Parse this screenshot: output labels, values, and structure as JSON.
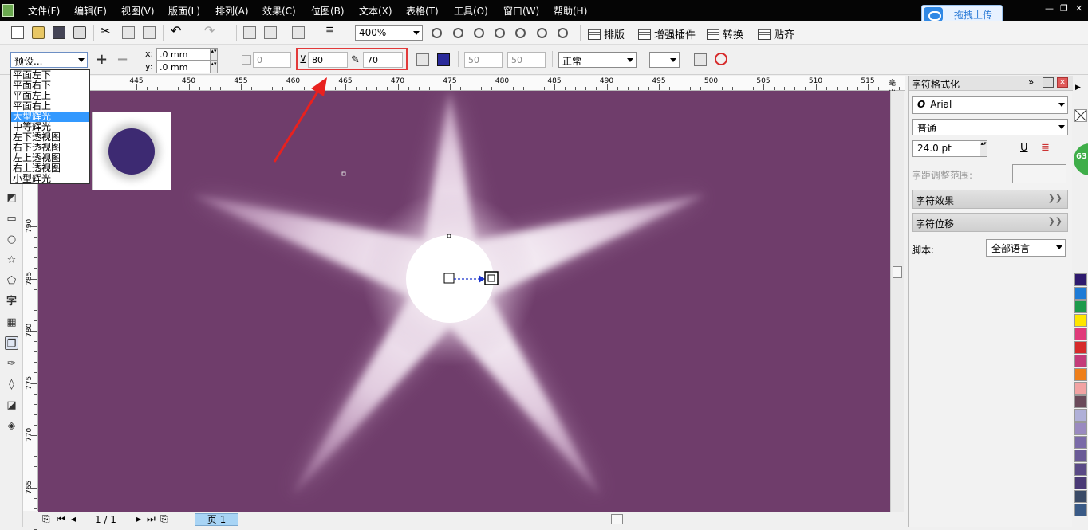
{
  "menu": [
    "文件(F)",
    "编辑(E)",
    "视图(V)",
    "版面(L)",
    "排列(A)",
    "效果(C)",
    "位图(B)",
    "文本(X)",
    "表格(T)",
    "工具(O)",
    "窗口(W)",
    "帮助(H)"
  ],
  "upload_button": "拖拽上传",
  "window_controls": {
    "minimize": "—",
    "restore": "❐",
    "close": "✕"
  },
  "toolbar1": {
    "zoom_level": "400%",
    "buttons": [
      "排版",
      "增强插件",
      "转换",
      "贴齐"
    ]
  },
  "toolbar2": {
    "preset": "预设...",
    "x_label": "x:",
    "y_label": "y:",
    "x_value": ".0 mm",
    "y_value": ".0 mm",
    "offset_value": "0",
    "opacity": "80",
    "feather": "70",
    "field_a": "50",
    "field_b": "50",
    "merge_mode": "正常"
  },
  "preset_options": [
    "平面左下",
    "平面右下",
    "平面左上",
    "平面右上",
    "大型辉光",
    "中等辉光",
    "左下透视图",
    "右下透视图",
    "左上透视图",
    "右上透视图",
    "小型辉光"
  ],
  "preset_selected_index": 4,
  "ruler_h": [
    "445",
    "450",
    "455",
    "460",
    "465",
    "470",
    "475",
    "480",
    "485",
    "490",
    "495",
    "500",
    "505",
    "510",
    "515",
    "毫米"
  ],
  "ruler_v": [
    "790",
    "785",
    "780",
    "775",
    "770",
    "765"
  ],
  "page_nav": {
    "counter": "1 / 1",
    "tab": "页 1"
  },
  "docker": {
    "title": "字符格式化",
    "font": "Arial",
    "style": "普通",
    "size": "24.0 pt",
    "spacing_label": "字距调整范围:",
    "section1": "字符效果",
    "section2": "字符位移",
    "script_label": "脚本:",
    "script_value": "全部语言"
  },
  "palette_badge": "63",
  "colors": {
    "canvas": "#6f3d6b",
    "preview_dot": "#3d2a72",
    "highlight": "#e23a3a",
    "selection": "#3399ff",
    "palette": [
      "#2e1a6e",
      "#1e7bd6",
      "#1d9a4b",
      "#ffe600",
      "#e03a7a",
      "#d62a2a",
      "#c43c7a",
      "#ef7f1a",
      "#f2a3a3",
      "#6a4a5a",
      "#b0b0d8",
      "#9a8ac0",
      "#7a6aa8",
      "#6a5a96",
      "#5a4a86",
      "#4a3a76",
      "#3a4a66",
      "#3a5a86"
    ]
  }
}
